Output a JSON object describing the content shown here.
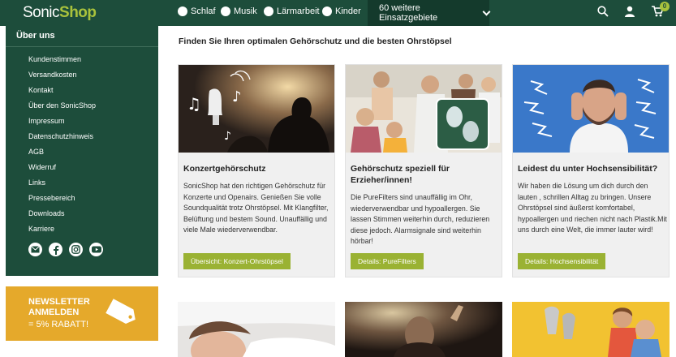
{
  "header": {
    "logo_part1": "Sonic",
    "logo_part2": "Shop",
    "filters": [
      "Schlaf",
      "Musik",
      "Lärmarbeit",
      "Kinder"
    ],
    "more_label": "60 weitere Einsatzgebiete",
    "cart_count": "0",
    "icons": [
      "search-icon",
      "user-icon",
      "cart-icon"
    ]
  },
  "sidebar": {
    "title": "Über uns",
    "items": [
      "Kundenstimmen",
      "Versandkosten",
      "Kontakt",
      "Über den SonicShop",
      "Impressum",
      "Datenschutzhinweis",
      "AGB",
      "Widerruf",
      "Links",
      "Pressebereich",
      "Downloads",
      "Karriere"
    ],
    "social_icons": [
      "mail-icon",
      "facebook-icon",
      "instagram-icon",
      "youtube-icon"
    ]
  },
  "newsletter": {
    "line1": "NEWSLETTER",
    "line2": "ANMELDEN",
    "line3": "= 5% RABATT!"
  },
  "main": {
    "headline": "Finden Sie Ihren optimalen Gehörschutz und die besten Ohrstöpsel",
    "cards": [
      {
        "title": "Konzertgehörschutz",
        "text": "SonicShop hat den richtigen Gehörschutz für Konzerte und Openairs. Genießen Sie volle Soundqualität trotz Ohrstöpsel. Mit Klangfilter, Belüftung und bestem Sound. Unauffällig und viele Male wiederverwendbar.",
        "button": "Übersicht: Konzert-Ohrstöpsel"
      },
      {
        "title": "Gehörschutz speziell für Erzieher/innen!",
        "text": "Die PureFilters sind unauffällig im Ohr, wiederverwendbar und hypoallergen. Sie lassen Stimmen weiterhin durch, reduzieren diese jedoch. Alarmsignale sind weiterhin hörbar!",
        "button": "Details: PureFilters"
      },
      {
        "title": "Leidest du unter Hochsensibilität?",
        "text": "Wir haben die Lösung um dich durch den lauten , schrillen Alltag zu bringen. Unsere Ohrstöpsel sind äußerst komfortabel, hypoallergen und riechen nicht nach Plastik.Mit uns durch eine Welt, die immer lauter wird!",
        "button": "Details: Hochsensibilität"
      }
    ]
  },
  "colors": {
    "brand_green": "#1d4d3b",
    "accent_green": "#9ab233",
    "newsletter_orange": "#e5a92b"
  }
}
